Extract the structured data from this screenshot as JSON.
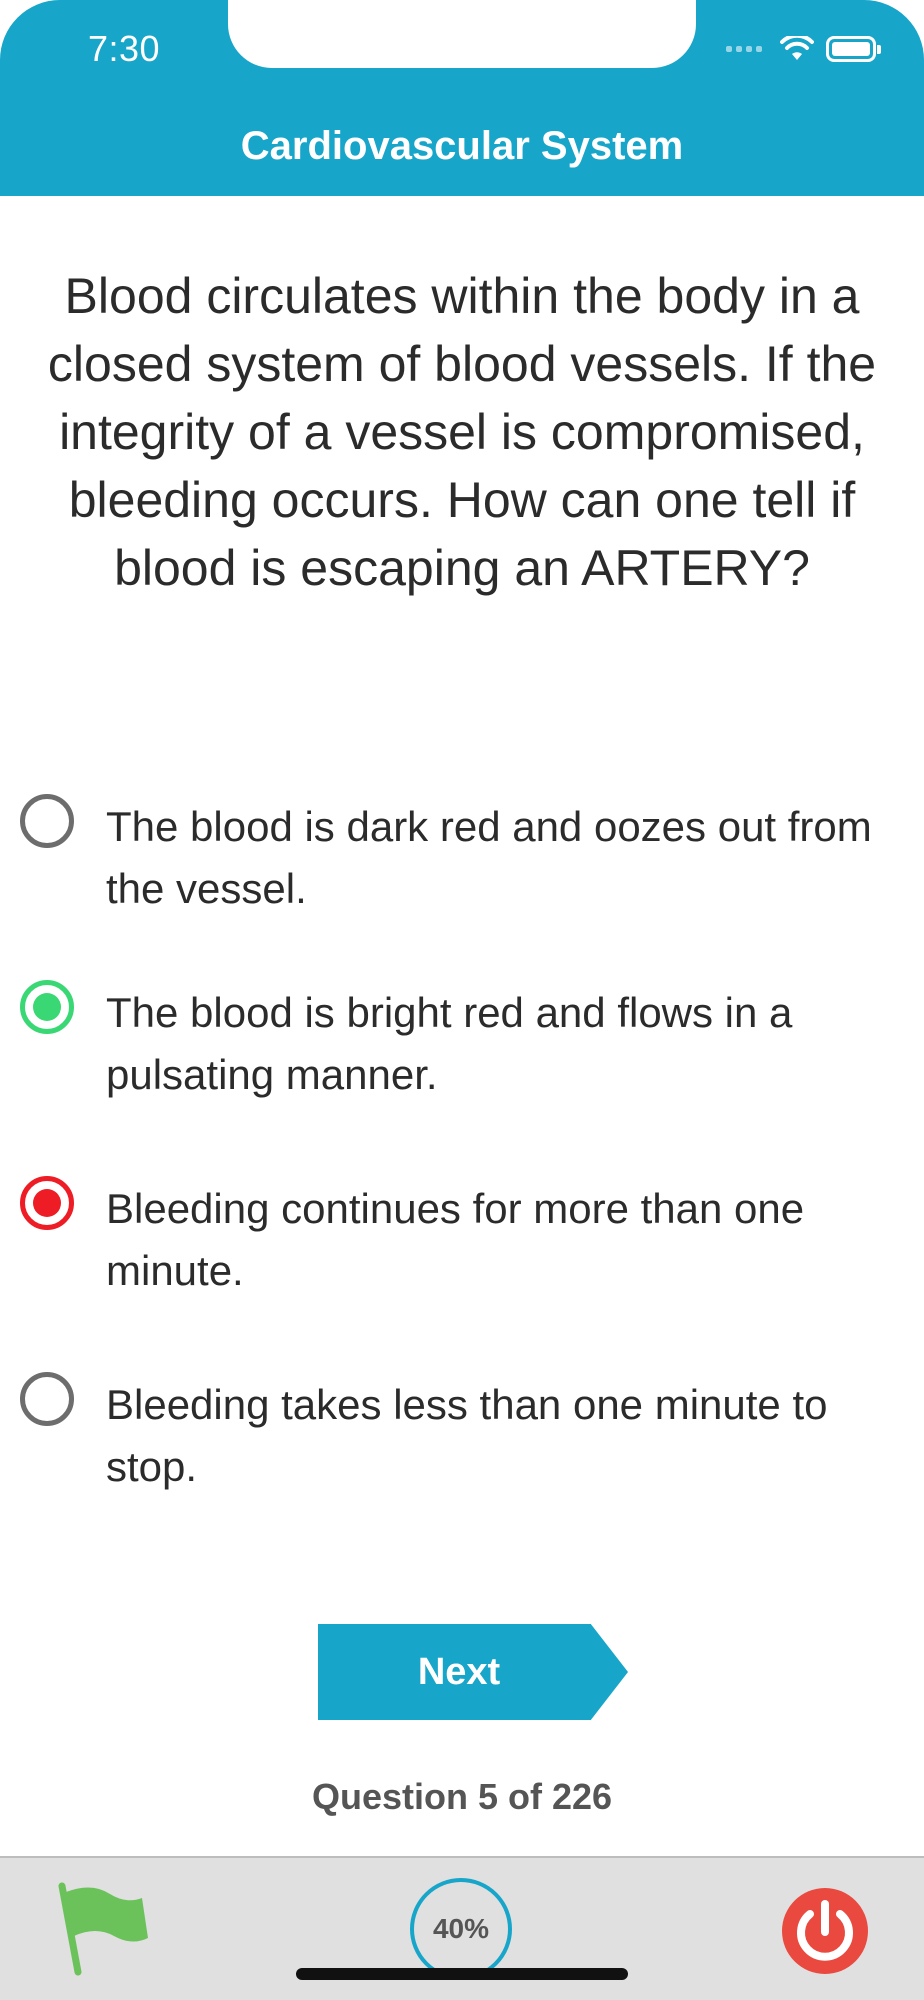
{
  "status_bar": {
    "time": "7:30"
  },
  "header": {
    "title": "Cardiovascular System"
  },
  "question": {
    "text": "Blood circulates within the body in a closed system of blood vessels. If the integrity of a vessel is compromised, bleeding occurs. How can one tell if blood is escaping an ARTERY?"
  },
  "options": [
    {
      "text": "The blood is dark red and oozes out from the vessel.",
      "state": "unselected"
    },
    {
      "text": "The blood is bright red and flows in a pulsating manner.",
      "state": "correct"
    },
    {
      "text": "Bleeding continues for more than one minute.",
      "state": "wrong"
    },
    {
      "text": "Bleeding takes less than one minute to stop.",
      "state": "unselected"
    }
  ],
  "next_button": {
    "label": "Next"
  },
  "progress": {
    "label": "Question 5 of 226",
    "percent_label": "40%"
  },
  "colors": {
    "accent": "#17a5c9",
    "correct": "#3ad775",
    "wrong": "#ee1c24",
    "flag": "#6cc25a",
    "power": "#e9493f"
  },
  "icons": {
    "flag": "flag-icon",
    "power": "power-icon",
    "wifi": "wifi-icon",
    "battery": "battery-icon",
    "signal": "signal-icon"
  }
}
